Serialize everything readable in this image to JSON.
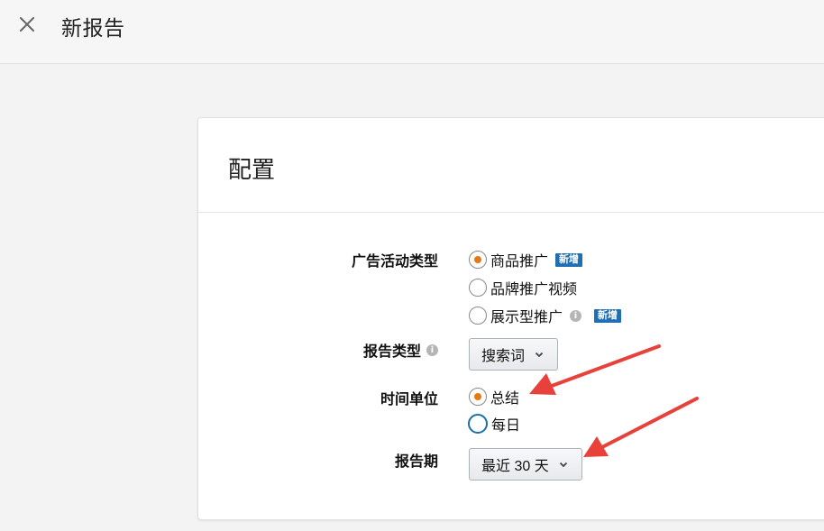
{
  "header": {
    "title": "新报告",
    "close_icon": "close-icon"
  },
  "config": {
    "title": "配置",
    "campaign_type": {
      "label": "广告活动类型",
      "options": [
        {
          "label": "商品推广",
          "badge": "新增",
          "checked": true
        },
        {
          "label": "品牌推广视频",
          "checked": false
        },
        {
          "label": "展示型推广",
          "badge": "新增",
          "info_icon": "info-icon",
          "checked": false
        }
      ]
    },
    "report_type": {
      "label": "报告类型",
      "info_icon": "info-icon",
      "value": "搜索词"
    },
    "time_unit": {
      "label": "时间单位",
      "options": [
        {
          "label": "总结",
          "checked": true
        },
        {
          "label": "每日",
          "checked": false,
          "focused": true
        }
      ]
    },
    "report_period": {
      "label": "报告期",
      "value": "最近 30 天"
    }
  },
  "colors": {
    "accent_orange": "#e47911",
    "badge_blue": "#1f6fb2",
    "annotation_red": "#e8403a"
  }
}
